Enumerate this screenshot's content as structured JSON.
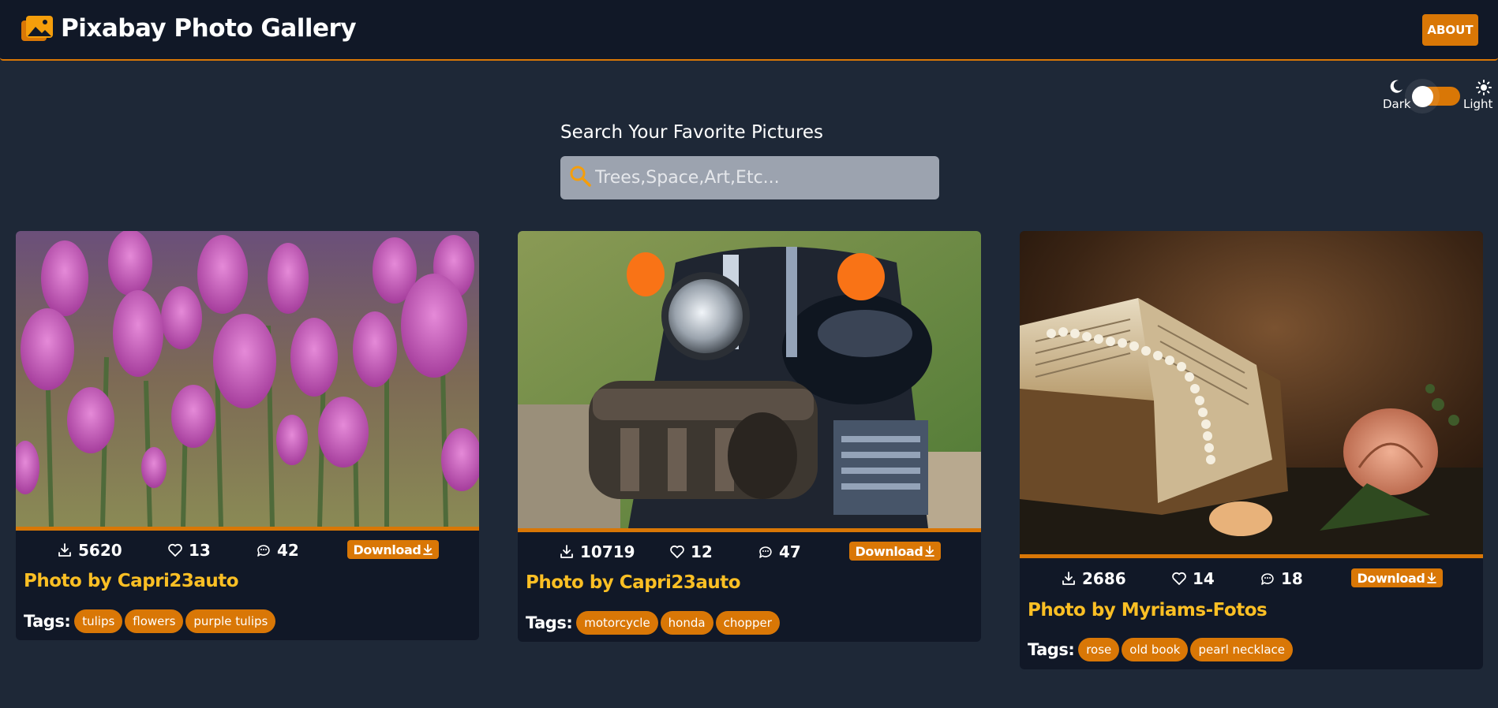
{
  "app": {
    "title": "Pixabay Photo Gallery",
    "about_label": "ABOUT",
    "accent_color": "#d97706",
    "name_color": "#fbbf24"
  },
  "theme_toggle": {
    "dark_label": "Dark",
    "light_label": "Light"
  },
  "search": {
    "heading": "Search Your Favorite Pictures",
    "placeholder": "Trees,Space,Art,Etc..."
  },
  "cards": [
    {
      "image": "purple tulips field",
      "downloads": "5620",
      "likes": "13",
      "comments": "42",
      "download_label": "Download",
      "photo_by": "Photo by Capri23auto",
      "tags_label": "Tags:",
      "tags": [
        "tulips",
        "flowers",
        "purple tulips"
      ]
    },
    {
      "image": "motorcycle front with leather bag",
      "downloads": "10719",
      "likes": "12",
      "comments": "47",
      "download_label": "Download",
      "photo_by": "Photo by Capri23auto",
      "tags_label": "Tags:",
      "tags": [
        "motorcycle",
        "honda",
        "chopper"
      ]
    },
    {
      "image": "old book with pearl necklace and rose",
      "downloads": "2686",
      "likes": "14",
      "comments": "18",
      "download_label": "Download",
      "photo_by": "Photo by Myriams-Fotos",
      "tags_label": "Tags:",
      "tags": [
        "rose",
        "old book",
        "pearl necklace"
      ]
    }
  ]
}
